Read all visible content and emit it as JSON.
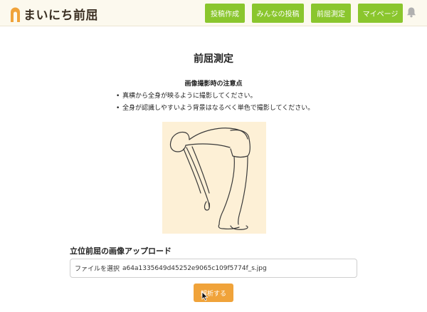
{
  "app": {
    "logo_text": "まいにち前屈"
  },
  "nav": {
    "items": [
      {
        "label": "投稿作成"
      },
      {
        "label": "みんなの投稿"
      },
      {
        "label": "前屈測定"
      },
      {
        "label": "マイページ"
      }
    ]
  },
  "main": {
    "title": "前屈測定",
    "notes_heading": "画像撮影時の注意点",
    "notes": [
      "真横から全身が映るように撮影してください。",
      "全身が認識しやすいよう背景はなるべく単色で撮影してください。"
    ],
    "upload_label": "立位前屈の画像アップロード",
    "file_input": {
      "button_text": "ファイルを選択",
      "filename": "a64a1335649d45252e9065c109f5774f_s.jpg"
    },
    "analyze_button": "解析する"
  },
  "colors": {
    "header_bg": "#fcf9ee",
    "nav_green": "#8ac62d",
    "accent_orange": "#f0a33a",
    "illustration_bg": "#fdf0d6"
  },
  "icons": {
    "logo": "arch-icon",
    "notifications": "bell-icon"
  }
}
